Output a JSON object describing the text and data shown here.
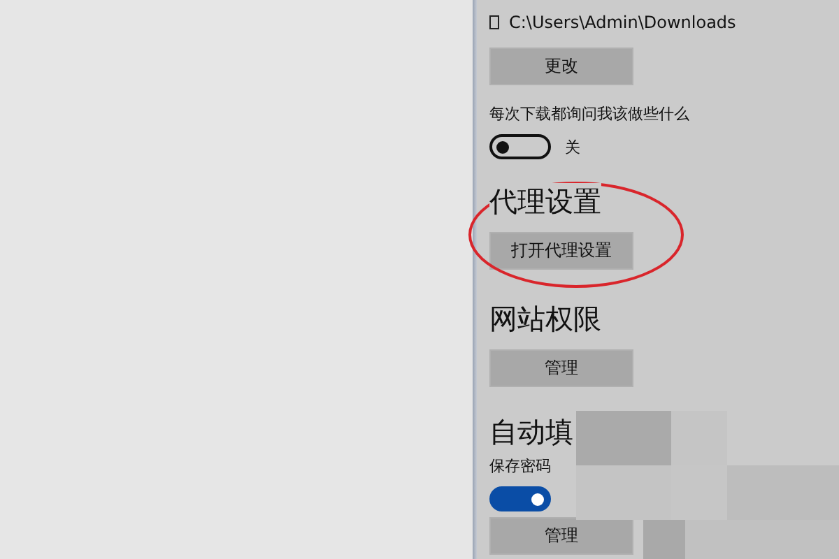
{
  "download": {
    "path": "C:\\Users\\Admin\\Downloads",
    "change_button": "更改",
    "ask_label": "每次下载都询问我该做些什么",
    "ask_toggle": {
      "on": false,
      "label": "关"
    }
  },
  "sections": [
    {
      "heading": "代理设置",
      "button": "打开代理设置",
      "highlighted": true
    },
    {
      "heading": "网站权限",
      "button": "管理",
      "highlighted": false
    }
  ],
  "autofill": {
    "heading": "自动填",
    "save_passwords_label": "保存密码",
    "save_passwords_toggle": {
      "on": true
    },
    "button": "管理"
  }
}
